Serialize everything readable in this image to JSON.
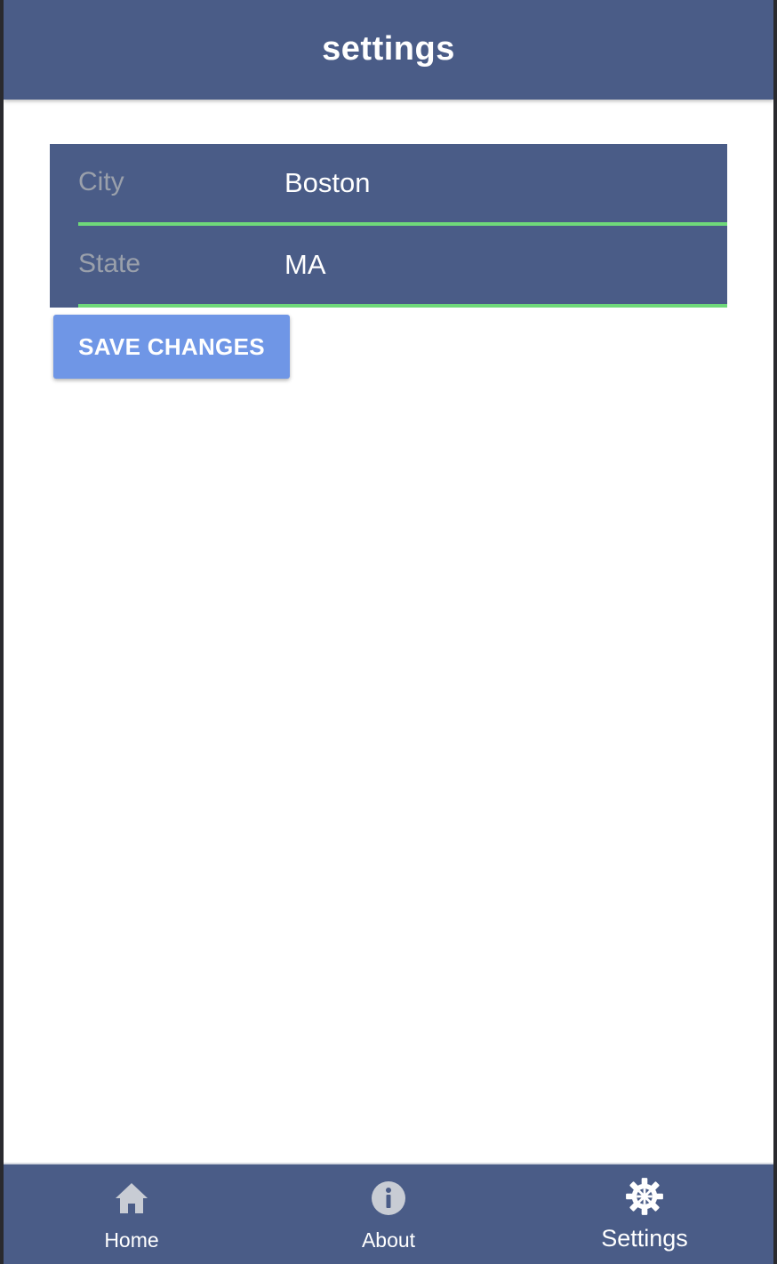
{
  "header": {
    "title": "settings",
    "background": "#4a5c87"
  },
  "form": {
    "fields": [
      {
        "label": "City",
        "value": "Boston"
      },
      {
        "label": "State",
        "value": "MA"
      }
    ],
    "underline_color": "#6fd97a"
  },
  "actions": {
    "save_label": "SAVE CHANGES",
    "save_color": "#6f96e6"
  },
  "bottom_nav": {
    "active": "settings",
    "items": [
      {
        "id": "home",
        "label": "Home",
        "icon": "home-icon"
      },
      {
        "id": "about",
        "label": "About",
        "icon": "info-icon"
      },
      {
        "id": "settings",
        "label": "Settings",
        "icon": "gear-icon"
      }
    ]
  }
}
